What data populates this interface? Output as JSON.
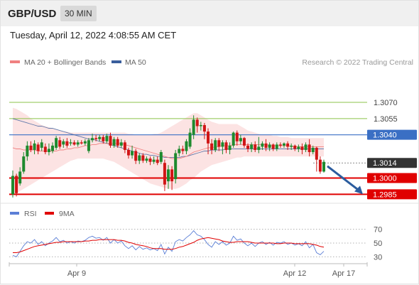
{
  "header": {
    "symbol": "GBP/USD",
    "timeframe": "30 MIN"
  },
  "timestamp": "Tuesday, April 12, 2022 4:08:55 AM CET",
  "legend": {
    "items": [
      {
        "label": "MA 20 + Bollinger Bands",
        "color": "#f08080"
      },
      {
        "label": "MA 50",
        "color": "#3a5e9c"
      }
    ],
    "credit": "Research © 2022 Trading Central"
  },
  "rsi_legend": {
    "items": [
      {
        "label": "RSI",
        "color": "#5b7fd6"
      },
      {
        "label": "9MA",
        "color": "#e00000"
      }
    ]
  },
  "colors": {
    "up": "#1e8a2e",
    "down": "#d01515",
    "resistance": "#8bc34a",
    "pivot": "#3a6fc4",
    "support": "#e00000",
    "current": "#333333",
    "arrow": "#2b5c9e"
  },
  "chart_data": {
    "type": "candlestick",
    "ylim": [
      1.2978,
      1.3095
    ],
    "x_ticks": [
      "Apr 9",
      "Apr 12",
      "Apr 17"
    ],
    "levels": [
      {
        "value": 1.307,
        "label": "1.3070",
        "kind": "resistance"
      },
      {
        "value": 1.3055,
        "label": "1.3055",
        "kind": "resistance"
      },
      {
        "value": 1.304,
        "label": "1.3040",
        "kind": "pivot"
      },
      {
        "value": 1.3014,
        "label": "1.3014",
        "kind": "current"
      },
      {
        "value": 1.3,
        "label": "1.3000",
        "kind": "support"
      },
      {
        "value": 1.2985,
        "label": "1.2985",
        "kind": "support"
      }
    ],
    "candles": [
      [
        1.2985,
        1.3002,
        1.2982,
        1.3007
      ],
      [
        1.3002,
        1.2986,
        1.2983,
        1.3004
      ],
      [
        1.2995,
        1.3006,
        1.2993,
        1.301
      ],
      [
        1.3006,
        1.302,
        1.3004,
        1.3024
      ],
      [
        1.302,
        1.303,
        1.3016,
        1.3034
      ],
      [
        1.303,
        1.3026,
        1.3024,
        1.3034
      ],
      [
        1.3026,
        1.3032,
        1.3022,
        1.3035
      ],
      [
        1.3031,
        1.3025,
        1.3022,
        1.3033
      ],
      [
        1.3028,
        1.3033,
        1.3025,
        1.3036
      ],
      [
        1.3029,
        1.3024,
        1.3022,
        1.3032
      ],
      [
        1.3024,
        1.3027,
        1.3021,
        1.3032
      ],
      [
        1.3025,
        1.303,
        1.3023,
        1.3033
      ],
      [
        1.3028,
        1.3037,
        1.3026,
        1.3039
      ],
      [
        1.3035,
        1.3029,
        1.3027,
        1.3038
      ],
      [
        1.3031,
        1.3034,
        1.3028,
        1.3036
      ],
      [
        1.3034,
        1.303,
        1.3028,
        1.3037
      ],
      [
        1.3032,
        1.3033,
        1.303,
        1.3036
      ],
      [
        1.3033,
        1.3031,
        1.303,
        1.3035
      ],
      [
        1.3031,
        1.3033,
        1.3029,
        1.3035
      ],
      [
        1.3033,
        1.3032,
        1.3031,
        1.3035
      ],
      [
        1.3032,
        1.3034,
        1.303,
        1.3036
      ],
      [
        1.3025,
        1.3035,
        1.3023,
        1.3037
      ],
      [
        1.3035,
        1.3037,
        1.3033,
        1.3041
      ],
      [
        1.3037,
        1.3036,
        1.3034,
        1.304
      ],
      [
        1.3036,
        1.3038,
        1.3034,
        1.304
      ],
      [
        1.3038,
        1.3034,
        1.3032,
        1.304
      ],
      [
        1.3034,
        1.3039,
        1.3032,
        1.3041
      ],
      [
        1.3039,
        1.303,
        1.3028,
        1.3042
      ],
      [
        1.303,
        1.3036,
        1.3028,
        1.3038
      ],
      [
        1.3036,
        1.303,
        1.3028,
        1.3038
      ],
      [
        1.303,
        1.3033,
        1.3028,
        1.3036
      ],
      [
        1.3033,
        1.3026,
        1.3023,
        1.3035
      ],
      [
        1.3026,
        1.3021,
        1.3018,
        1.3028
      ],
      [
        1.3021,
        1.3025,
        1.3018,
        1.303
      ],
      [
        1.3025,
        1.3016,
        1.3013,
        1.3027
      ],
      [
        1.3016,
        1.3021,
        1.3013,
        1.3023
      ],
      [
        1.3021,
        1.3016,
        1.3014,
        1.3023
      ],
      [
        1.3016,
        1.3018,
        1.3014,
        1.302
      ],
      [
        1.3018,
        1.3015,
        1.3012,
        1.302
      ],
      [
        1.3015,
        1.3017,
        1.3013,
        1.302
      ],
      [
        1.3017,
        1.3014,
        1.3012,
        1.302
      ],
      [
        1.3015,
        1.3024,
        1.3013,
        1.3026
      ],
      [
        1.3014,
        1.2994,
        1.2988,
        1.3017
      ],
      [
        1.2997,
        1.3008,
        1.299,
        1.3012
      ],
      [
        1.3008,
        1.2997,
        1.2989,
        1.3011
      ],
      [
        1.2999,
        1.3023,
        1.2995,
        1.3026
      ],
      [
        1.3023,
        1.3027,
        1.302,
        1.303
      ],
      [
        1.3027,
        1.3025,
        1.3022,
        1.303
      ],
      [
        1.3025,
        1.3034,
        1.3022,
        1.3036
      ],
      [
        1.3029,
        1.3042,
        1.3027,
        1.3046
      ],
      [
        1.304,
        1.3054,
        1.3036,
        1.3058
      ],
      [
        1.3054,
        1.3048,
        1.3042,
        1.3056
      ],
      [
        1.3048,
        1.3049,
        1.3044,
        1.3052
      ],
      [
        1.3049,
        1.3043,
        1.3036,
        1.3051
      ],
      [
        1.3043,
        1.3032,
        1.3022,
        1.3046
      ],
      [
        1.3032,
        1.3026,
        1.3022,
        1.3036
      ],
      [
        1.3026,
        1.3035,
        1.3024,
        1.3037
      ],
      [
        1.3035,
        1.3029,
        1.3025,
        1.3037
      ],
      [
        1.3029,
        1.3033,
        1.3022,
        1.3035
      ],
      [
        1.3033,
        1.3026,
        1.3023,
        1.3035
      ],
      [
        1.3026,
        1.303,
        1.3022,
        1.3033
      ],
      [
        1.303,
        1.3042,
        1.3028,
        1.3043
      ],
      [
        1.3042,
        1.3034,
        1.303,
        1.3044
      ],
      [
        1.3034,
        1.3037,
        1.3031,
        1.304
      ],
      [
        1.3037,
        1.303,
        1.3028,
        1.3038
      ],
      [
        1.303,
        1.3027,
        1.3024,
        1.3032
      ],
      [
        1.3027,
        1.3031,
        1.3024,
        1.3033
      ],
      [
        1.3031,
        1.3026,
        1.3024,
        1.3034
      ],
      [
        1.3026,
        1.3029,
        1.3023,
        1.3038
      ],
      [
        1.3029,
        1.3032,
        1.3026,
        1.3034
      ],
      [
        1.3032,
        1.3028,
        1.3025,
        1.3036
      ],
      [
        1.3028,
        1.3031,
        1.3025,
        1.3033
      ],
      [
        1.3031,
        1.3027,
        1.3025,
        1.3032
      ],
      [
        1.3027,
        1.3031,
        1.3025,
        1.3033
      ],
      [
        1.3031,
        1.303,
        1.3028,
        1.3033
      ],
      [
        1.303,
        1.3032,
        1.3028,
        1.3033
      ],
      [
        1.3032,
        1.3029,
        1.3026,
        1.3034
      ],
      [
        1.3029,
        1.303,
        1.3026,
        1.3032
      ],
      [
        1.303,
        1.3027,
        1.3025,
        1.3031
      ],
      [
        1.3027,
        1.3029,
        1.3024,
        1.3031
      ],
      [
        1.3029,
        1.3026,
        1.3022,
        1.3032
      ],
      [
        1.3026,
        1.3031,
        1.3024,
        1.3033
      ],
      [
        1.3031,
        1.3024,
        1.302,
        1.3036
      ],
      [
        1.3024,
        1.3028,
        1.3022,
        1.303
      ],
      [
        1.3028,
        1.3017,
        1.3006,
        1.3029
      ],
      [
        1.3017,
        1.3006,
        1.3004,
        1.302
      ],
      [
        1.3006,
        1.3015,
        1.3005,
        1.3017
      ]
    ],
    "ma50": [
      1.3055,
      1.3054,
      1.3053,
      1.3052,
      1.3051,
      1.305,
      1.3049,
      1.3048,
      1.3048,
      1.3047,
      1.3046,
      1.3046,
      1.3045,
      1.3044,
      1.3043,
      1.3042,
      1.3041,
      1.304,
      1.3039,
      1.3038,
      1.3037,
      1.3036,
      1.3036,
      1.3035,
      1.3034,
      1.3033,
      1.3032,
      1.3031,
      1.303,
      1.3029,
      1.3028,
      1.3027,
      1.3026,
      1.3025,
      1.3024,
      1.3023,
      1.3022,
      1.3022,
      1.3021,
      1.3021,
      1.302,
      1.302,
      1.3019,
      1.3019,
      1.3019,
      1.3019,
      1.3019,
      1.302,
      1.302,
      1.3021,
      1.3022,
      1.3023,
      1.3024,
      1.3025,
      1.3025,
      1.3026,
      1.3026,
      1.3026,
      1.3026,
      1.3027,
      1.3027,
      1.3027,
      1.3027,
      1.3027,
      1.3027,
      1.3027,
      1.3027,
      1.3027,
      1.3027,
      1.3027,
      1.3027,
      1.3027,
      1.3027,
      1.3027,
      1.3027,
      1.3027,
      1.3027,
      1.3027,
      1.3027,
      1.3027,
      1.3027,
      1.3027,
      1.3027,
      1.3027,
      1.3027,
      1.3027,
      1.3027
    ],
    "ma20": [
      1.3028,
      1.3027,
      1.3027,
      1.3026,
      1.3026,
      1.3026,
      1.3026,
      1.3025,
      1.3025,
      1.3025,
      1.3025,
      1.3025,
      1.3025,
      1.3026,
      1.3026,
      1.3027,
      1.3027,
      1.3028,
      1.3028,
      1.3029,
      1.303,
      1.303,
      1.3031,
      1.3031,
      1.3032,
      1.3032,
      1.3032,
      1.3032,
      1.3032,
      1.3032,
      1.3032,
      1.3031,
      1.303,
      1.3029,
      1.3028,
      1.3027,
      1.3026,
      1.3025,
      1.3024,
      1.3023,
      1.3022,
      1.3021,
      1.302,
      1.3019,
      1.3018,
      1.3018,
      1.3018,
      1.3019,
      1.302,
      1.3022,
      1.3024,
      1.3025,
      1.3026,
      1.3027,
      1.3028,
      1.3028,
      1.3029,
      1.3029,
      1.303,
      1.303,
      1.303,
      1.3031,
      1.3031,
      1.3031,
      1.3031,
      1.3031,
      1.3031,
      1.3031,
      1.3031,
      1.3031,
      1.3031,
      1.303,
      1.303,
      1.303,
      1.303,
      1.303,
      1.303,
      1.3029,
      1.3029,
      1.3029,
      1.3029,
      1.3029,
      1.3029,
      1.3029,
      1.3029,
      1.3029,
      1.3029
    ],
    "bb_upper": [
      1.3065,
      1.3064,
      1.3062,
      1.306,
      1.3058,
      1.3055,
      1.3053,
      1.3051,
      1.3049,
      1.3048,
      1.3047,
      1.3046,
      1.3045,
      1.3044,
      1.3043,
      1.3043,
      1.3042,
      1.3042,
      1.3042,
      1.3042,
      1.3042,
      1.3042,
      1.3042,
      1.3042,
      1.3042,
      1.3042,
      1.3042,
      1.3042,
      1.3042,
      1.3042,
      1.3042,
      1.3042,
      1.3041,
      1.3041,
      1.304,
      1.304,
      1.304,
      1.304,
      1.304,
      1.3041,
      1.3041,
      1.3042,
      1.3044,
      1.3046,
      1.3048,
      1.305,
      1.3052,
      1.3054,
      1.3056,
      1.3058,
      1.306,
      1.306,
      1.3058,
      1.3056,
      1.3054,
      1.3052,
      1.3051,
      1.305,
      1.305,
      1.305,
      1.305,
      1.305,
      1.305,
      1.3048,
      1.3046,
      1.3044,
      1.3043,
      1.3042,
      1.3041,
      1.304,
      1.304,
      1.304,
      1.3039,
      1.3039,
      1.3038,
      1.3038,
      1.3038,
      1.3037,
      1.3037,
      1.3037,
      1.3037,
      1.3037,
      1.3037,
      1.3037,
      1.3037,
      1.3037,
      1.3037
    ],
    "bb_lower": [
      1.2985,
      1.2986,
      1.2988,
      1.299,
      1.2992,
      1.2994,
      1.2996,
      1.2998,
      1.3,
      1.3002,
      1.3004,
      1.3006,
      1.3008,
      1.301,
      1.3012,
      1.3014,
      1.3016,
      1.3017,
      1.3018,
      1.3018,
      1.3018,
      1.3018,
      1.3018,
      1.3018,
      1.3018,
      1.3018,
      1.3017,
      1.3016,
      1.3015,
      1.3013,
      1.3011,
      1.3009,
      1.3007,
      1.3005,
      1.3003,
      1.3001,
      1.2999,
      1.2997,
      1.2995,
      1.2994,
      1.2993,
      1.2992,
      1.2991,
      1.299,
      1.299,
      1.299,
      1.2991,
      1.2993,
      1.2995,
      1.2998,
      1.3,
      1.3003,
      1.3006,
      1.3008,
      1.301,
      1.3012,
      1.3013,
      1.3014,
      1.3015,
      1.3016,
      1.3017,
      1.3018,
      1.3019,
      1.3019,
      1.302,
      1.302,
      1.302,
      1.302,
      1.302,
      1.302,
      1.302,
      1.302,
      1.302,
      1.302,
      1.302,
      1.302,
      1.302,
      1.302,
      1.302,
      1.302,
      1.302,
      1.302,
      1.302,
      1.302,
      1.302,
      1.302,
      1.302
    ],
    "arrow": {
      "from": 1.3011,
      "to": 1.2985
    },
    "rsi": {
      "ylim": [
        22,
        80
      ],
      "ticks": [
        70,
        50,
        30
      ],
      "rsi": [
        32,
        30,
        38,
        46,
        52,
        50,
        55,
        48,
        52,
        46,
        50,
        53,
        58,
        52,
        54,
        50,
        52,
        50,
        53,
        52,
        54,
        58,
        60,
        57,
        58,
        54,
        58,
        50,
        55,
        50,
        53,
        46,
        42,
        46,
        40,
        45,
        41,
        43,
        40,
        42,
        39,
        48,
        34,
        44,
        38,
        52,
        55,
        53,
        58,
        62,
        68,
        62,
        60,
        55,
        48,
        44,
        52,
        48,
        52,
        47,
        50,
        60,
        54,
        56,
        50,
        46,
        50,
        45,
        50,
        52,
        48,
        51,
        47,
        51,
        50,
        52,
        48,
        50,
        47,
        49,
        46,
        52,
        43,
        48,
        36,
        33,
        38
      ],
      "ma9": [
        36,
        36,
        37,
        39,
        41,
        43,
        45,
        46,
        47,
        48,
        49,
        50,
        51,
        51,
        52,
        52,
        52,
        52,
        52,
        52,
        53,
        53,
        54,
        54,
        55,
        55,
        55,
        55,
        55,
        54,
        54,
        53,
        51,
        50,
        48,
        47,
        46,
        45,
        43,
        42,
        42,
        42,
        41,
        41,
        41,
        42,
        44,
        45,
        47,
        49,
        51,
        54,
        56,
        57,
        58,
        57,
        56,
        55,
        53,
        52,
        51,
        51,
        52,
        52,
        52,
        52,
        51,
        50,
        50,
        50,
        50,
        50,
        50,
        49,
        49,
        50,
        50,
        50,
        49,
        49,
        49,
        49,
        49,
        48,
        47,
        45,
        44
      ]
    }
  }
}
